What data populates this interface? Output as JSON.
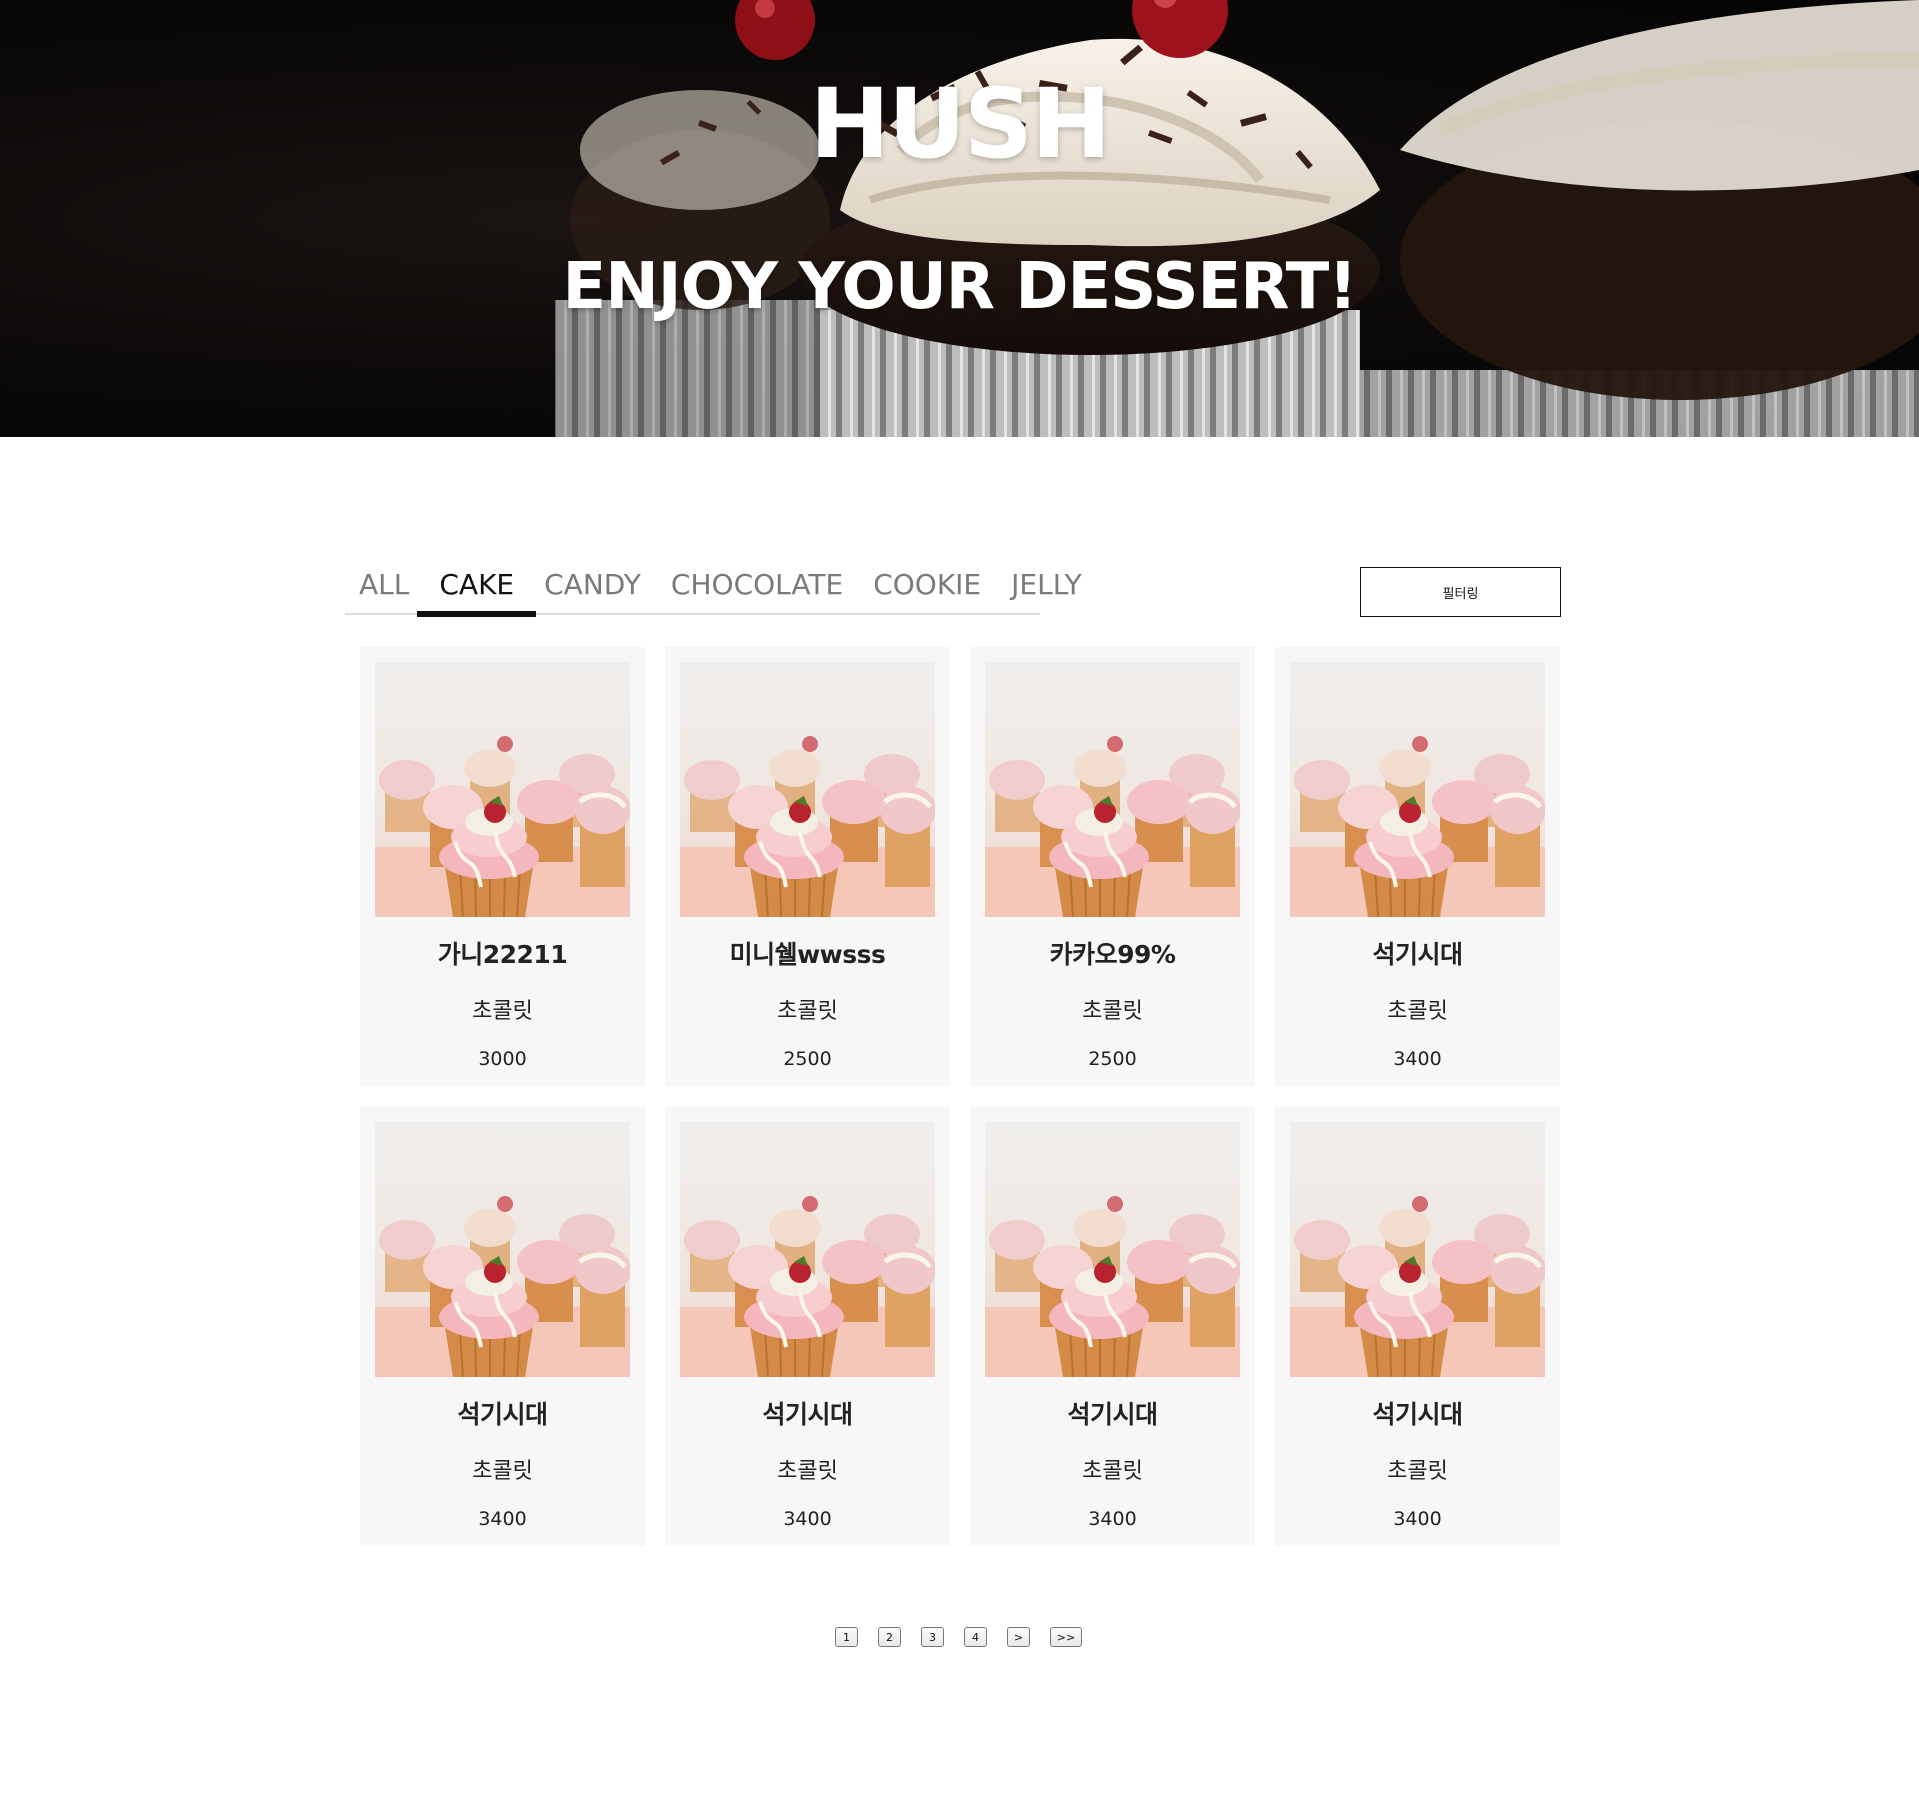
{
  "hero": {
    "title": "HUSH",
    "subtitle": "ENJOY YOUR DESSERT!"
  },
  "tabs": [
    {
      "label": "ALL",
      "active": false
    },
    {
      "label": "CAKE",
      "active": true
    },
    {
      "label": "CANDY",
      "active": false
    },
    {
      "label": "CHOCOLATE",
      "active": false
    },
    {
      "label": "COOKIE",
      "active": false
    },
    {
      "label": "JELLY",
      "active": false
    }
  ],
  "filter_button": "필터링",
  "products": [
    {
      "name": "가니22211",
      "category": "초콜릿",
      "price": "3000"
    },
    {
      "name": "미니쉘wwsss",
      "category": "초콜릿",
      "price": "2500"
    },
    {
      "name": "카카오99%",
      "category": "초콜릿",
      "price": "2500"
    },
    {
      "name": "석기시대",
      "category": "초콜릿",
      "price": "3400"
    },
    {
      "name": "석기시대",
      "category": "초콜릿",
      "price": "3400"
    },
    {
      "name": "석기시대",
      "category": "초콜릿",
      "price": "3400"
    },
    {
      "name": "석기시대",
      "category": "초콜릿",
      "price": "3400"
    },
    {
      "name": "석기시대",
      "category": "초콜릿",
      "price": "3400"
    }
  ],
  "pagination": {
    "pages": [
      "1",
      "2",
      "3",
      "4"
    ],
    "next": ">",
    "last": ">>"
  },
  "colors": {
    "tab_active": "#111111",
    "tab_inactive": "#7a7a7a",
    "card_bg": "#f7f7f7"
  }
}
